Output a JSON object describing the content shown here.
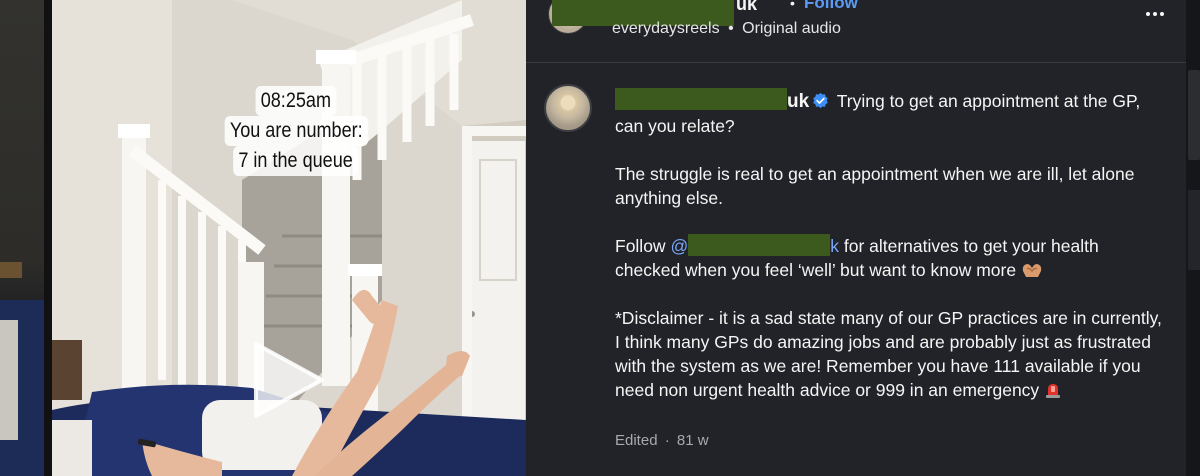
{
  "video": {
    "caption_lines": [
      "08:25am",
      "You are number:",
      "7 in the queue"
    ],
    "play_icon": "play-icon"
  },
  "header": {
    "username_suffix": "uk",
    "separator": "•",
    "follow_label": "Follow",
    "audio_account": "everydaysreels",
    "audio_separator": "•",
    "audio_label": "Original audio",
    "more_icon": "more-horizontal-icon"
  },
  "comment": {
    "username_suffix": "uk",
    "intro_text": "Trying to get an appointment at the GP, can you relate?",
    "paragraph_2": "The struggle is real to get an appointment when we are ill, let alone anything else.",
    "follow_prefix": "Follow",
    "mention_prefix": "@",
    "mention_suffix": "k",
    "follow_suffix": "for alternatives to get your health checked when you feel ‘well’ but want to know more",
    "paragraph_4": "*Disclaimer - it is a sad state many of our GP practices are in currently, I think many GPs do amazing jobs and are probably just as frustrated with the system as we are! Remember you have 111 available if you need non urgent health advice or 999 in an emergency",
    "edited_label": "Edited",
    "meta_separator": "·",
    "age": "81 w"
  },
  "colors": {
    "panel_bg": "#212328",
    "link_blue": "#5b9bf5",
    "verified_blue": "#3e8ef7",
    "redaction_green": "#3c5a1e"
  }
}
